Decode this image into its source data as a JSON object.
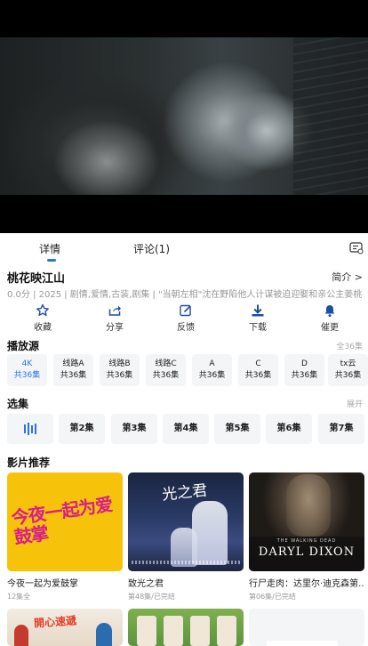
{
  "tabs": {
    "details": "详情",
    "comments": "评论(1)"
  },
  "show": {
    "title": "桃花映江山",
    "intro_link": "简介 >",
    "meta": "0.0分  | 2025  |  剧情,爱情,古装,剧集  |  \"当朝左相\"沈在野陷他人计谋被迫迎娶和亲公主姜桃花"
  },
  "actions": [
    {
      "label": "收藏",
      "icon": "star-icon"
    },
    {
      "label": "分享",
      "icon": "share-icon"
    },
    {
      "label": "反馈",
      "icon": "edit-icon"
    },
    {
      "label": "下载",
      "icon": "download-icon"
    },
    {
      "label": "催更",
      "icon": "bell-icon"
    }
  ],
  "sources_section": {
    "title": "播放源",
    "right": "全36集",
    "items": [
      {
        "name": "4K",
        "count": "共36集",
        "active": true
      },
      {
        "name": "线路A",
        "count": "共36集"
      },
      {
        "name": "线路B",
        "count": "共36集"
      },
      {
        "name": "线路C",
        "count": "共36集"
      },
      {
        "name": "A",
        "count": "共36集"
      },
      {
        "name": "C",
        "count": "共36集"
      },
      {
        "name": "D",
        "count": "共36集"
      },
      {
        "name": "tx云",
        "count": "共36集"
      }
    ]
  },
  "episodes_section": {
    "title": "选集",
    "right": "展开",
    "items": [
      "playing",
      "第2集",
      "第3集",
      "第4集",
      "第5集",
      "第6集",
      "第7集"
    ]
  },
  "recommend_section": {
    "title": "影片推荐",
    "items": [
      {
        "title": "今夜一起为爱鼓掌",
        "sub": "12集全",
        "poster_text": "今夜一起为爱鼓掌"
      },
      {
        "title": "致光之君",
        "sub": "第48集/已完结",
        "poster_text": "光之君"
      },
      {
        "title": "行尸走肉：达里尔·迪克森第...",
        "sub": "第06集/已完结",
        "poster_text_small": "THE WALKING DEAD",
        "poster_text": "DARYL DIXON"
      }
    ],
    "row2": [
      {
        "poster_text": "開心速遞"
      }
    ]
  },
  "colors": {
    "accent": "#2a72e8",
    "chip_bg": "#f4f5f7"
  }
}
